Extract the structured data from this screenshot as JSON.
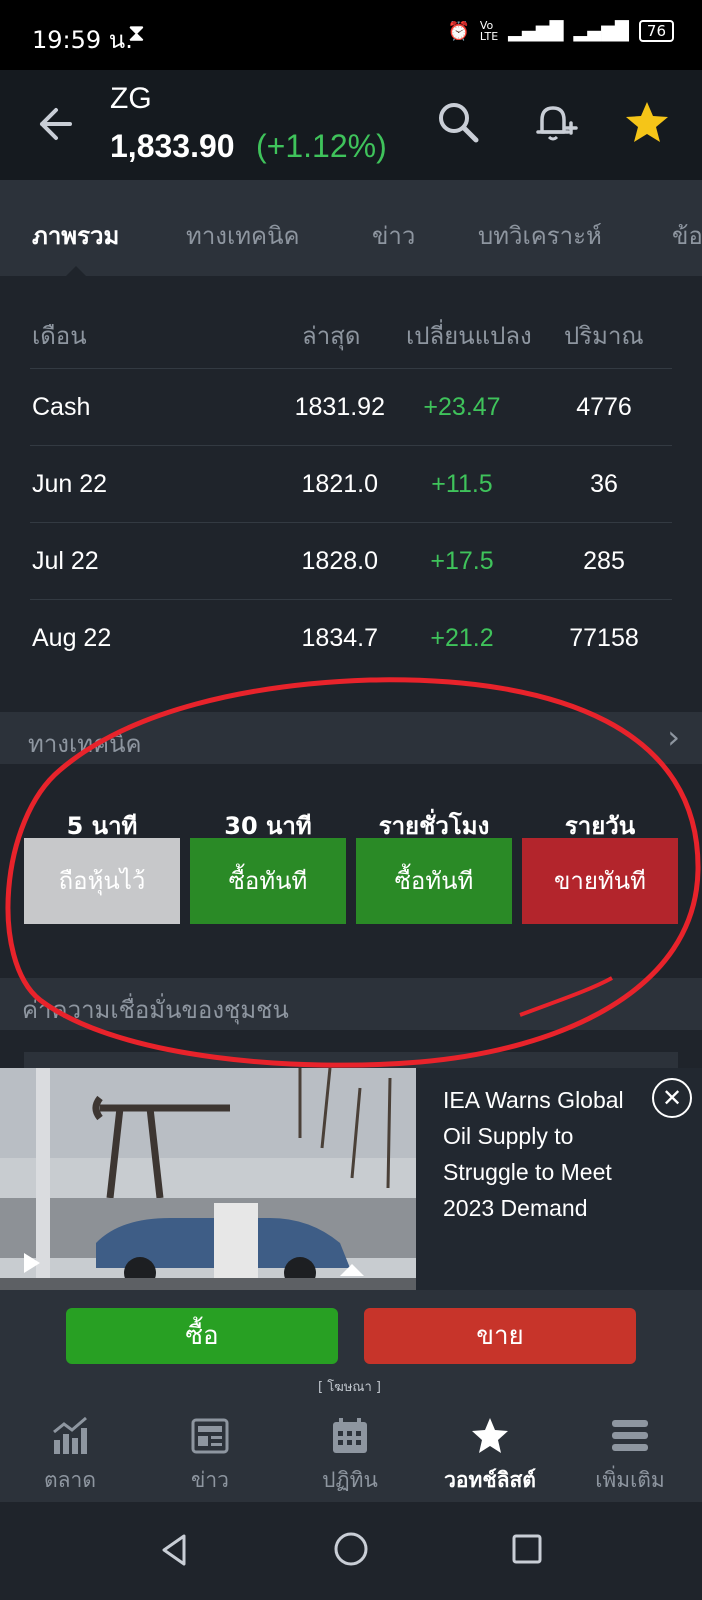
{
  "status_bar": {
    "time": "19:59 น.",
    "battery": "76"
  },
  "header": {
    "symbol": "ZG",
    "price": "1,833.90",
    "change": "(+1.12%)"
  },
  "tabs": [
    "ภาพรวม",
    "ทางเทคนิค",
    "ข่าว",
    "บทวิเคราะห์",
    "ข้อ"
  ],
  "table": {
    "headers": [
      "เดือน",
      "ล่าสุด",
      "เปลี่ยนแปลง",
      "ปริมาณ"
    ],
    "rows": [
      {
        "month": "Cash",
        "last": "1831.92",
        "change": "+23.47",
        "volume": "4776"
      },
      {
        "month": "Jun 22",
        "last": "1821.0",
        "change": "+11.5",
        "volume": "36"
      },
      {
        "month": "Jul 22",
        "last": "1828.0",
        "change": "+17.5",
        "volume": "285"
      },
      {
        "month": "Aug 22",
        "last": "1834.7",
        "change": "+21.2",
        "volume": "77158"
      }
    ]
  },
  "technical": {
    "title": "ทางเทคนิค",
    "signals": [
      {
        "period": "5 นาที",
        "action": "ถือหุ้นไว้"
      },
      {
        "period": "30 นาที",
        "action": "ซื้อทันที"
      },
      {
        "period": "รายชั่วโมง",
        "action": "ซื้อทันที"
      },
      {
        "period": "รายวัน",
        "action": "ขายทันที"
      }
    ]
  },
  "sentiment": {
    "title": "ค่าความเชื่อมั่นของชุมชน"
  },
  "ad": {
    "title": "IEA Warns Global Oil Supply to Struggle to Meet 2023 Demand",
    "tag": "[ โฆษณา ]"
  },
  "trade": {
    "buy": "ซื้อ",
    "sell": "ขาย"
  },
  "bottom_nav": [
    {
      "label": "ตลาด",
      "icon": "chart-icon"
    },
    {
      "label": "ข่าว",
      "icon": "news-icon"
    },
    {
      "label": "ปฏิทิน",
      "icon": "calendar-icon"
    },
    {
      "label": "วอทช์ลิสต์",
      "icon": "star-icon",
      "active": true
    },
    {
      "label": "เพิ่มเติม",
      "icon": "menu-icon"
    }
  ],
  "colors": {
    "positive": "#3fc35b",
    "buy": "#2a8a26",
    "sell": "#b3252c",
    "neutral": "#c7c8ca",
    "star": "#f5c518",
    "annotation": "#e8232b"
  }
}
